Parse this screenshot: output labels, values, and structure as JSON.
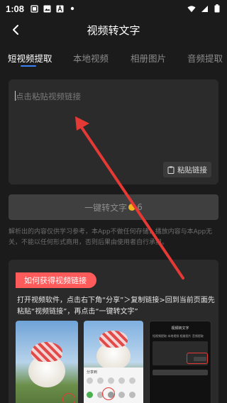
{
  "status_bar": {
    "time": "1:08",
    "left_icons": [
      "notification-icon",
      "photo-icon",
      "font-icon",
      "dot"
    ],
    "right_icons": [
      "wifi-icon",
      "signal-icon",
      "battery-icon"
    ]
  },
  "nav": {
    "title": "视频转文字",
    "back_icon": "back-chevron-icon"
  },
  "tabs": [
    {
      "label": "短视频提取",
      "active": true
    },
    {
      "label": "本地视频",
      "active": false
    },
    {
      "label": "相册图片",
      "active": false
    },
    {
      "label": "音频提取",
      "active": false
    }
  ],
  "input": {
    "placeholder": "点击粘贴视频链接",
    "paste_label": "粘贴链接",
    "paste_icon": "clipboard-icon"
  },
  "convert": {
    "label": "一键转文字",
    "cost": "6",
    "coin_icon": "coin-icon"
  },
  "disclaimer": "解析出的内容仅供学习参考，本App不做任何存储，播放内容与本App无关，不能以任何形式商用，否则后果由使用者自行承担。",
  "guide": {
    "badge": "如何获得视频链接",
    "text": "打开视频软件，点击右下角“分享”＞复制链接>回到当前页面先粘贴“视频链接”，再点击“一键转文字”",
    "shot3_title": "视频转文字",
    "shot3_tabs": "短视频提取  本地视频  相册图片  音频提取",
    "sheet_title": "分享到"
  },
  "colors": {
    "background": "#1b1b1b",
    "accent_blue": "#3b82f6",
    "badge_red": "#ff5b5b",
    "arrow_red": "#e53935",
    "coin": "#f2b41a"
  }
}
